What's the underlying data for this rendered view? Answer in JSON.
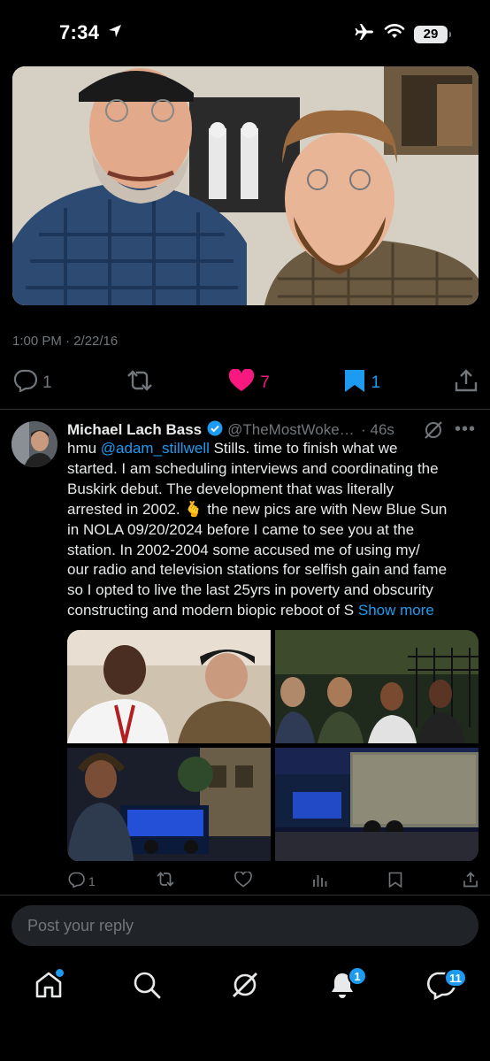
{
  "status_bar": {
    "time": "7:34",
    "battery": "29"
  },
  "post": {
    "timestamp": "1:00 PM · 2/22/16",
    "replies": "1",
    "likes": "7",
    "bookmarks": "1"
  },
  "reply": {
    "author_name": "Michael Lach Bass",
    "handle": "@TheMostWokeO...",
    "time": "· 46s",
    "text_lines": [
      "hmu ",
      "@adam_stillwell",
      " Stills.  time to finish what we",
      "started.  I am scheduling interviews and coordinating the",
      "Buskirk debut.  The development that was literally",
      "arrested in 2002. 🫰 the new pics are with New Blue Sun",
      "in NOLA 09/20/2024 before I came to see you at the",
      "station.  In 2002-2004 some accused me of using my/",
      "our radio and television stations for selfish gain and fame",
      "so I opted to live the last 25yrs in poverty and obscurity",
      "constructing and modern biopic reboot of S "
    ],
    "show_more": "Show more",
    "reply_count": "1"
  },
  "composer": {
    "placeholder": "Post your reply"
  },
  "nav": {
    "notifications_badge": "1",
    "messages_badge": "11"
  },
  "colors": {
    "accent": "#1d9bf0",
    "like": "#f91880",
    "muted": "#71767b",
    "background": "#000000"
  }
}
